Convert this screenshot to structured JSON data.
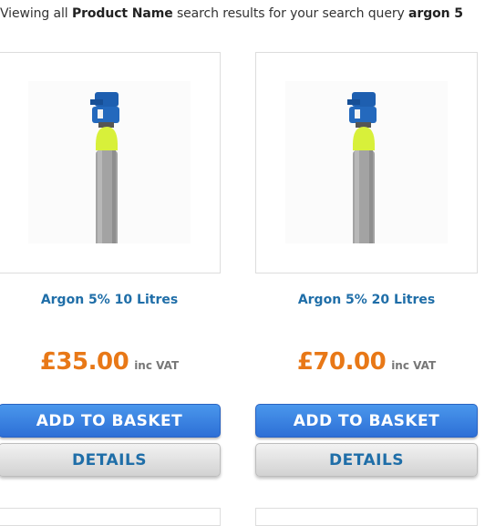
{
  "search": {
    "prefix": "Viewing all ",
    "field": "Product Name",
    "middle": " search results for your search query ",
    "query": "argon 5"
  },
  "products": [
    {
      "name": "Argon 5% 10 Litres",
      "price": "£35.00",
      "vat_label": "inc VAT",
      "basket_label": "ADD TO BASKET",
      "details_label": "DETAILS",
      "image_icon": "gas-cylinder-icon"
    },
    {
      "name": "Argon 5% 20 Litres",
      "price": "£70.00",
      "vat_label": "inc VAT",
      "basket_label": "ADD TO BASKET",
      "details_label": "DETAILS",
      "image_icon": "gas-cylinder-icon"
    }
  ],
  "colors": {
    "product_name": "#1f6ea8",
    "price": "#e87817",
    "basket_button": "#2d6fd6",
    "details_button": "#d2d2d2",
    "cylinder_body": "#a3a3a3",
    "cylinder_shoulder": "#d8f03a",
    "valve_cap": "#1e5fb0"
  }
}
